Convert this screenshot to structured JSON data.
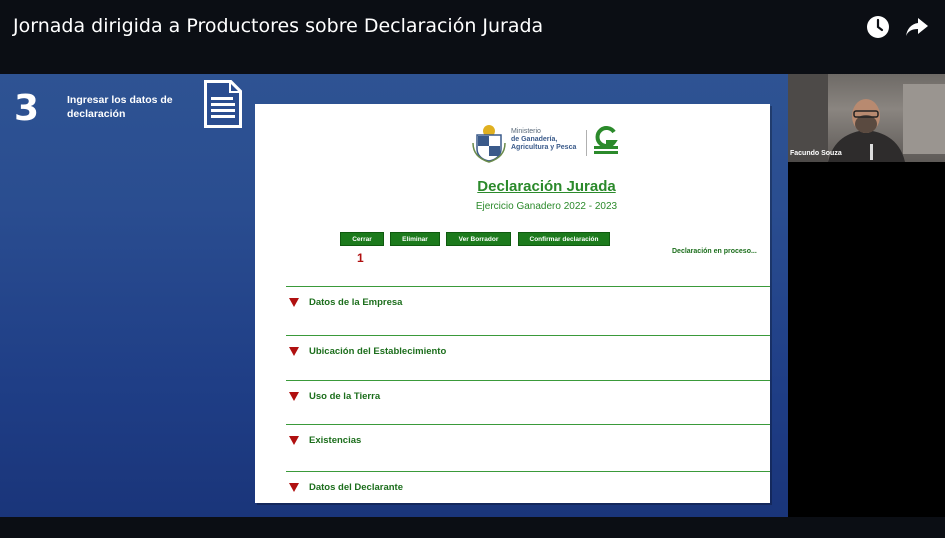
{
  "video": {
    "title": "Jornada dirigida a Productores sobre Declaración Jurada",
    "icons": [
      "clock-icon",
      "share-icon"
    ]
  },
  "slide": {
    "step_number": "3",
    "step_text": "Ingresar los datos de declaración",
    "icon": "document-icon"
  },
  "form": {
    "ministry_lines": [
      "Ministerio",
      "de Ganadería,",
      "Agricultura y Pesca"
    ],
    "title": "Declaración Jurada",
    "subtitle": "Ejercicio Ganadero  2022 - 2023",
    "buttons": {
      "close": "Cerrar",
      "delete": "Eliminar",
      "draft": "Ver Borrador",
      "confirm": "Confirmar declaración"
    },
    "marker": "1",
    "status": "Declaración en proceso...",
    "sections": [
      "Datos de la Empresa",
      "Ubicación del Establecimiento",
      "Uso de la Tierra",
      "Existencias",
      "Datos del Declarante"
    ]
  },
  "participant": {
    "name": "Facundo Souza"
  },
  "colors": {
    "slide_blue": "#2a4d90",
    "form_green": "#2b8a2b",
    "button_green": "#1c7a1c",
    "marker_red": "#b01010"
  }
}
